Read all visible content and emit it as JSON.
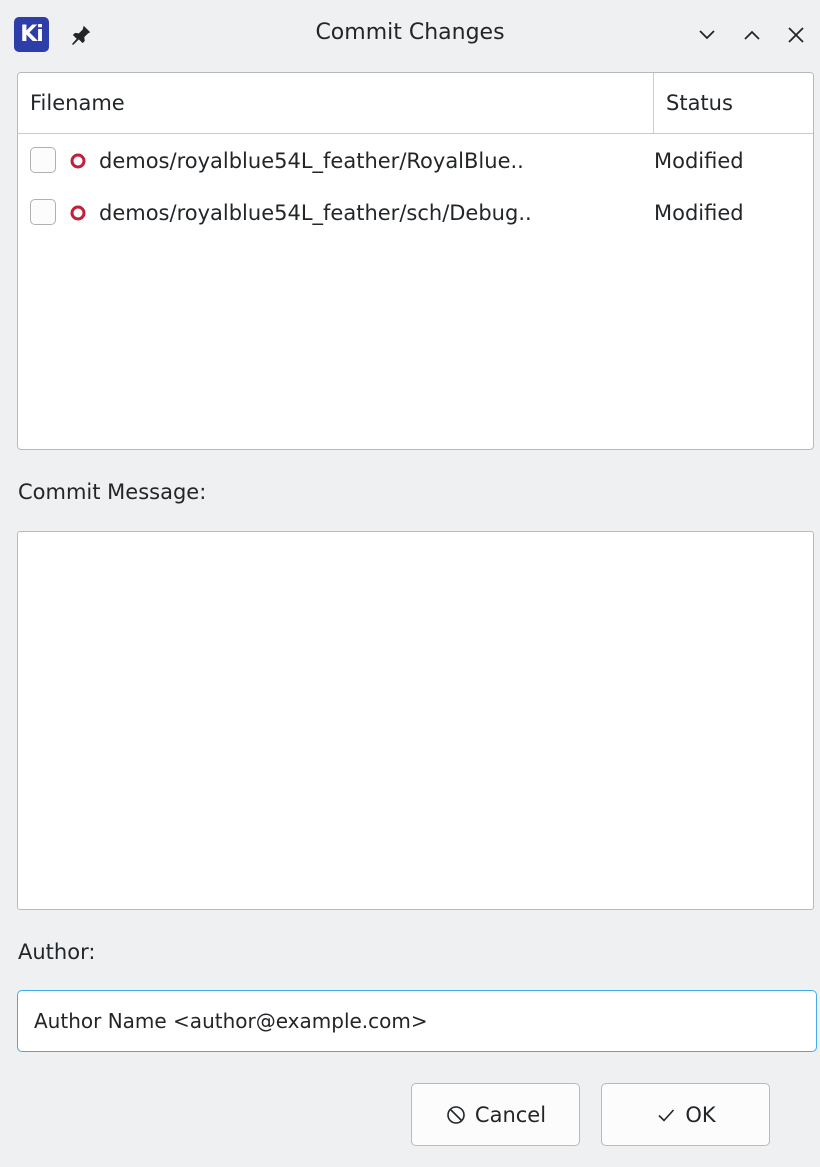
{
  "window": {
    "title": "Commit Changes",
    "app_logo_text": "Ki",
    "icons": [
      "pin-icon",
      "minimize-icon",
      "maximize-icon",
      "close-icon"
    ]
  },
  "file_list": {
    "columns": [
      "Filename",
      "Status"
    ],
    "rows": [
      {
        "checked": false,
        "filename": "demos/royalblue54L_feather/RoyalBlue..",
        "status": "Modified",
        "status_icon": "modified-circle-icon"
      },
      {
        "checked": false,
        "filename": "demos/royalblue54L_feather/sch/Debug..",
        "status": "Modified",
        "status_icon": "modified-circle-icon"
      }
    ]
  },
  "commit_message": {
    "label": "Commit Message:",
    "value": ""
  },
  "author": {
    "label": "Author:",
    "value": "Author Name <author@example.com>"
  },
  "buttons": {
    "cancel_label": "Cancel",
    "ok_label": "OK"
  },
  "colors": {
    "accent": "#3daee9",
    "logo": "#2e3ea8",
    "modified": "#c0203b"
  }
}
